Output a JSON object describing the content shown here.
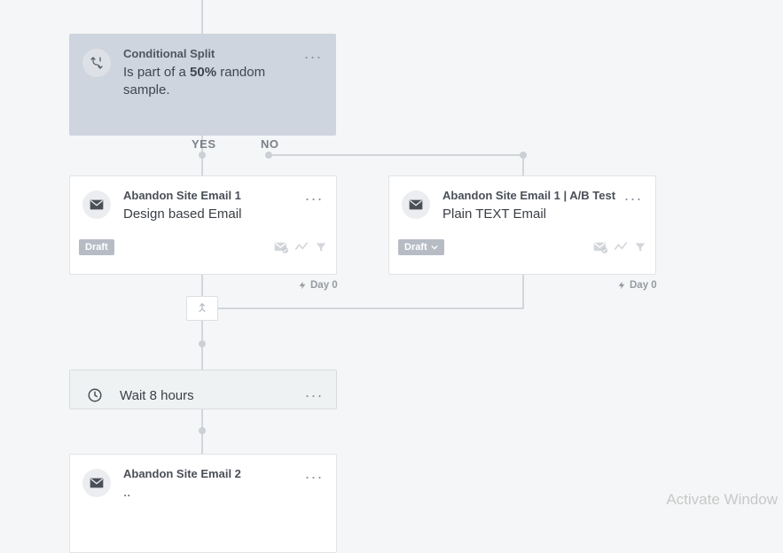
{
  "split": {
    "title": "Conditional Split",
    "desc_pre": "Is part of a ",
    "desc_strong": "50%",
    "desc_post": " random sample."
  },
  "branches": {
    "yes": "YES",
    "no": "NO"
  },
  "email1": {
    "title": "Abandon Site Email 1",
    "desc": "Design based Email",
    "badge": "Draft",
    "day": "Day 0"
  },
  "email1b": {
    "title": "Abandon Site Email 1 | A/B Test",
    "desc": "Plain TEXT Email",
    "badge": "Draft",
    "day": "Day 0"
  },
  "wait": {
    "text": "Wait 8 hours"
  },
  "email2": {
    "title": "Abandon Site Email 2",
    "desc": ".."
  },
  "watermark": "Activate Window"
}
